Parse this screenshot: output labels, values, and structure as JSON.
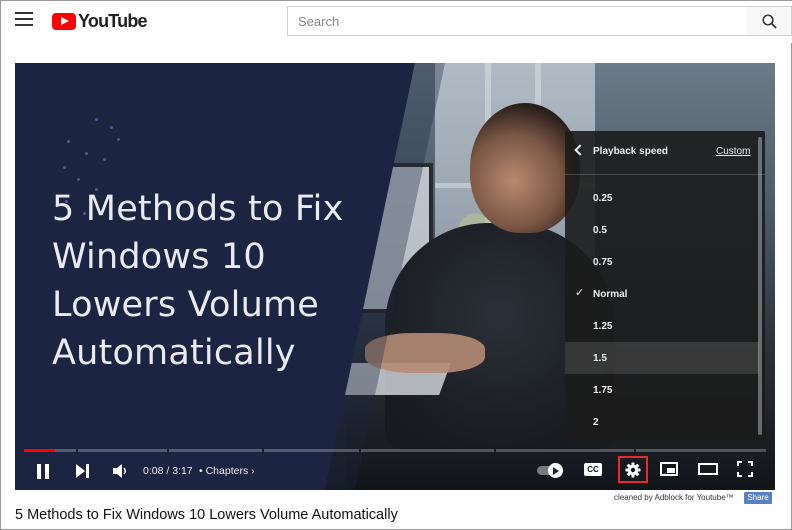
{
  "header": {
    "logo_text": "YouTube",
    "search_placeholder": "Search"
  },
  "video": {
    "thumbnail_title_lines": [
      "5 Methods to Fix",
      "Windows 10",
      "Lowers Volume",
      "Automatically"
    ],
    "time_display": "0:08 / 3:17",
    "chapters_label": "• Chapters",
    "progress_fraction": 0.042,
    "cc_label": "CC"
  },
  "speed_menu": {
    "title": "Playback speed",
    "custom_label": "Custom",
    "options": [
      "0.25",
      "0.5",
      "0.75",
      "Normal",
      "1.25",
      "1.5",
      "1.75",
      "2"
    ],
    "checked_option": "Normal",
    "highlighted_option": "1.5",
    "check_glyph": "✓"
  },
  "footer": {
    "adblock_note": "cleaned by Adblock for Youtube™",
    "share_label": "Share",
    "page_title": "5 Methods to Fix Windows 10 Lowers Volume Automatically"
  },
  "colors": {
    "brand_red": "#ff0000",
    "settings_highlight": "#e52b2b",
    "share_blue": "#5a80c4"
  }
}
